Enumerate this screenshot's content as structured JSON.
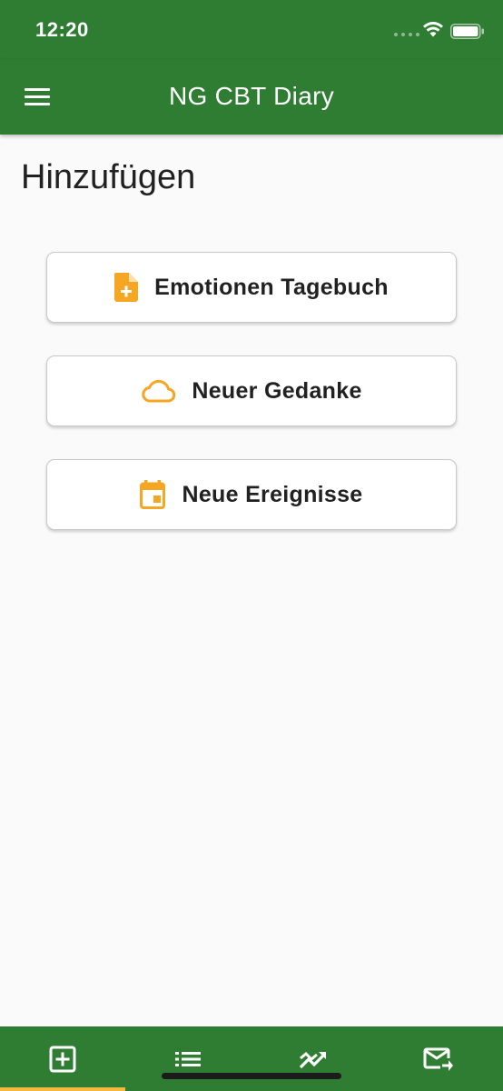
{
  "status_bar": {
    "time": "12:20"
  },
  "app_bar": {
    "title": "NG CBT Diary",
    "menu_icon": "menu-icon"
  },
  "page": {
    "title": "Hinzufügen"
  },
  "actions": [
    {
      "label": "Emotionen Tagebuch",
      "icon": "note-add-icon"
    },
    {
      "label": "Neuer Gedanke",
      "icon": "cloud-icon"
    },
    {
      "label": "Neue Ereignisse",
      "icon": "calendar-icon"
    }
  ],
  "bottom_nav": {
    "items": [
      {
        "icon": "add-box-icon",
        "selected": true
      },
      {
        "icon": "list-icon",
        "selected": false
      },
      {
        "icon": "trending-icon",
        "selected": false
      },
      {
        "icon": "send-mail-icon",
        "selected": false
      }
    ]
  },
  "colors": {
    "primary": "#2e7d32",
    "accent": "#f5a623",
    "indicator": "#f5b942",
    "background": "#fafafa"
  }
}
